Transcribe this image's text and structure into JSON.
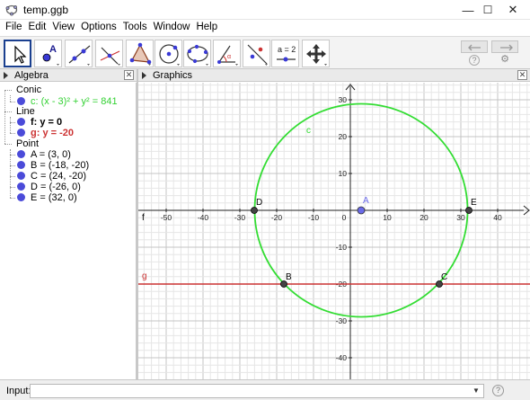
{
  "window": {
    "title": "temp.ggb",
    "minimize": "—",
    "maximize": "☐",
    "close": "✕"
  },
  "menu": [
    "File",
    "Edit",
    "View",
    "Options",
    "Tools",
    "Window",
    "Help"
  ],
  "toolbar": {
    "tools": [
      "move",
      "point",
      "line",
      "perpendicular-line",
      "polygon",
      "circle-center-point",
      "conic-five-points",
      "angle",
      "reflect",
      "slider",
      "move-graphics-view"
    ],
    "slider_text": "a = 2",
    "help_glyph": "?",
    "settings_glyph": "⚙"
  },
  "algebra": {
    "header": "Algebra",
    "groups": [
      {
        "label": "Conic",
        "items": [
          {
            "text": "c: (x - 3)² + y² = 841",
            "color": "#32d132"
          }
        ]
      },
      {
        "label": "Line",
        "items": [
          {
            "text": "f: y = 0",
            "color": "#000000"
          },
          {
            "text": "g: y = -20",
            "color": "#cc3333"
          }
        ]
      },
      {
        "label": "Point",
        "items": [
          {
            "text": "A = (3, 0)",
            "color": "#000000"
          },
          {
            "text": "B = (-18, -20)",
            "color": "#000000"
          },
          {
            "text": "C = (24, -20)",
            "color": "#000000"
          },
          {
            "text": "D = (-26, 0)",
            "color": "#000000"
          },
          {
            "text": "E = (32, 0)",
            "color": "#000000"
          }
        ]
      }
    ]
  },
  "graphics": {
    "header": "Graphics",
    "x_ticks": [
      "-50",
      "-40",
      "-30",
      "-20",
      "-10",
      "0",
      "10",
      "20",
      "30",
      "40"
    ],
    "y_ticks": [
      "30",
      "20",
      "10",
      "-10",
      "-20",
      "-30",
      "-40"
    ],
    "labels": {
      "conic": "c",
      "line_f": "f",
      "line_g": "g",
      "A": "A",
      "B": "B",
      "C": "C",
      "D": "D",
      "E": "E"
    },
    "colors": {
      "circle": "#33dd33",
      "line_g": "#cc3333",
      "point_A": "#6a6ae8",
      "grid": "#d9d9d9"
    }
  },
  "input": {
    "label": "Input:",
    "value": "",
    "dropdown": "▼",
    "help": "?"
  }
}
